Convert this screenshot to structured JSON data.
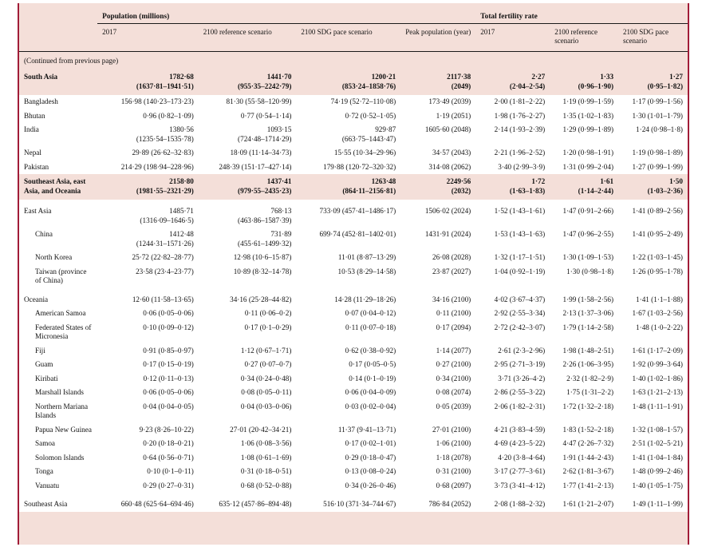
{
  "header": {
    "groups": [
      {
        "label": "Population (millions)",
        "span": 4
      },
      {
        "label": "Total fertility rate",
        "span": 3
      }
    ],
    "columns": [
      "",
      "2017",
      "2100 reference scenario",
      "2100 SDG pace scenario",
      "Peak population (year)",
      "2017",
      "2100 reference scenario",
      "2100 SDG pace scenario"
    ]
  },
  "note": "(Continued from previous page)",
  "rows": [
    {
      "kind": "region",
      "level": 0,
      "name": "South Asia",
      "pop_2017": "1782·68\n(1637·81–1941·51)",
      "pop_2100_ref": "1441·70\n(955·35–2242·79)",
      "pop_2100_sdg": "1200·21\n(853·24–1858·76)",
      "peak_pop": "2117·38\n(2049)",
      "tfr_2017": "2·27\n(2·04–2·54)",
      "tfr_2100_ref": "1·33\n(0·96–1·90)",
      "tfr_2100_sdg": "1·27\n(0·95–1·82)"
    },
    {
      "kind": "country",
      "level": 1,
      "name": "Bangladesh",
      "pop_2017": "156·98 (140·23–173·23)",
      "pop_2100_ref": "81·30 (55·58–120·99)",
      "pop_2100_sdg": "74·19 (52·72–110·08)",
      "peak_pop": "173·49 (2039)",
      "tfr_2017": "2·00 (1·81–2·22)",
      "tfr_2100_ref": "1·19 (0·99–1·59)",
      "tfr_2100_sdg": "1·17 (0·99–1·56)"
    },
    {
      "kind": "country",
      "level": 1,
      "name": "Bhutan",
      "pop_2017": "0·96 (0·82–1·09)",
      "pop_2100_ref": "0·77 (0·54–1·14)",
      "pop_2100_sdg": "0·72 (0·52–1·05)",
      "peak_pop": "1·19 (2051)",
      "tfr_2017": "1·98 (1·76–2·27)",
      "tfr_2100_ref": "1·35 (1·02–1·83)",
      "tfr_2100_sdg": "1·30 (1·01–1·79)"
    },
    {
      "kind": "country",
      "level": 1,
      "name": "India",
      "pop_2017": "1380·56\n(1235·54–1535·78)",
      "pop_2100_ref": "1093·15\n(724·48–1714·29)",
      "pop_2100_sdg": "929·87\n(663·75–1443·47)",
      "peak_pop": "1605·60 (2048)",
      "tfr_2017": "2·14 (1·93–2·39)",
      "tfr_2100_ref": "1·29 (0·99–1·89)",
      "tfr_2100_sdg": "1·24 (0·98–1·8)"
    },
    {
      "kind": "country",
      "level": 1,
      "name": "Nepal",
      "pop_2017": "29·89 (26·62–32·83)",
      "pop_2100_ref": "18·09 (11·14–34·73)",
      "pop_2100_sdg": "15·55 (10·34–29·96)",
      "peak_pop": "34·57 (2043)",
      "tfr_2017": "2·21 (1·96–2·52)",
      "tfr_2100_ref": "1·20 (0·98–1·91)",
      "tfr_2100_sdg": "1·19 (0·98–1·89)"
    },
    {
      "kind": "country",
      "level": 1,
      "name": "Pakistan",
      "pop_2017": "214·29 (198·94–228·96)",
      "pop_2100_ref": "248·39 (151·17–427·14)",
      "pop_2100_sdg": "179·88 (120·72–320·32)",
      "peak_pop": "314·08 (2062)",
      "tfr_2017": "3·40 (2·99–3·9)",
      "tfr_2100_ref": "1·31 (0·99–2·04)",
      "tfr_2100_sdg": "1·27 (0·99–1·99)"
    },
    {
      "kind": "region",
      "level": 0,
      "name": "Southeast Asia, east Asia, and Oceania",
      "pop_2017": "2158·80\n(1981·55–2321·29)",
      "pop_2100_ref": "1437·41\n(979·55–2435·23)",
      "pop_2100_sdg": "1263·48\n(864·11–2156·81)",
      "peak_pop": "2249·56\n(2032)",
      "tfr_2017": "1·72\n(1·63–1·83)",
      "tfr_2100_ref": "1·61\n(1·14–2·44)",
      "tfr_2100_sdg": "1·50\n(1·03–2·36)"
    },
    {
      "kind": "subregion",
      "level": 1,
      "name": "East Asia",
      "pop_2017": "1485·71\n(1316·09–1646·5)",
      "pop_2100_ref": "768·13\n(463·86–1587·39)",
      "pop_2100_sdg": "733·09 (457·41–1486·17)",
      "peak_pop": "1506·02 (2024)",
      "tfr_2017": "1·52 (1·43–1·61)",
      "tfr_2100_ref": "1·47 (0·91–2·66)",
      "tfr_2100_sdg": "1·41 (0·89–2·56)"
    },
    {
      "kind": "country",
      "level": 2,
      "name": "China",
      "pop_2017": "1412·48\n(1244·31–1571·26)",
      "pop_2100_ref": "731·89\n(455·61–1499·32)",
      "pop_2100_sdg": "699·74 (452·81–1402·01)",
      "peak_pop": "1431·91 (2024)",
      "tfr_2017": "1·53 (1·43–1·63)",
      "tfr_2100_ref": "1·47 (0·96–2·55)",
      "tfr_2100_sdg": "1·41 (0·95–2·49)"
    },
    {
      "kind": "country",
      "level": 2,
      "name": "North Korea",
      "pop_2017": "25·72 (22·82–28·77)",
      "pop_2100_ref": "12·98 (10·6–15·87)",
      "pop_2100_sdg": "11·01 (8·87–13·29)",
      "peak_pop": "26·08 (2028)",
      "tfr_2017": "1·32 (1·17–1·51)",
      "tfr_2100_ref": "1·30 (1·09–1·53)",
      "tfr_2100_sdg": "1·22 (1·03–1·45)"
    },
    {
      "kind": "country",
      "level": 2,
      "name": "Taiwan (province of China)",
      "pop_2017": "23·58 (23·4–23·77)",
      "pop_2100_ref": "10·89 (8·32–14·78)",
      "pop_2100_sdg": "10·53 (8·29–14·58)",
      "peak_pop": "23·87 (2027)",
      "tfr_2017": "1·04 (0·92–1·19)",
      "tfr_2100_ref": "1·30 (0·98–1·8)",
      "tfr_2100_sdg": "1·26 (0·95–1·78)"
    },
    {
      "kind": "subregion",
      "level": 1,
      "name": "Oceania",
      "pop_2017": "12·60 (11·58–13·65)",
      "pop_2100_ref": "34·16 (25·28–44·82)",
      "pop_2100_sdg": "14·28 (11·29–18·26)",
      "peak_pop": "34·16 (2100)",
      "tfr_2017": "4·02 (3·67–4·37)",
      "tfr_2100_ref": "1·99 (1·58–2·56)",
      "tfr_2100_sdg": "1·41 (1·1–1·88)"
    },
    {
      "kind": "country",
      "level": 2,
      "name": "American Samoa",
      "pop_2017": "0·06 (0·05–0·06)",
      "pop_2100_ref": "0·11 (0·06–0·2)",
      "pop_2100_sdg": "0·07 (0·04–0·12)",
      "peak_pop": "0·11 (2100)",
      "tfr_2017": "2·92 (2·55–3·34)",
      "tfr_2100_ref": "2·13 (1·37–3·06)",
      "tfr_2100_sdg": "1·67 (1·03–2·56)"
    },
    {
      "kind": "country",
      "level": 2,
      "name": "Federated States of Micronesia",
      "pop_2017": "0·10 (0·09–0·12)",
      "pop_2100_ref": "0·17 (0·1–0·29)",
      "pop_2100_sdg": "0·11 (0·07–0·18)",
      "peak_pop": "0·17 (2094)",
      "tfr_2017": "2·72 (2·42–3·07)",
      "tfr_2100_ref": "1·79 (1·14–2·58)",
      "tfr_2100_sdg": "1·48 (1·0–2·22)"
    },
    {
      "kind": "country",
      "level": 2,
      "name": "Fiji",
      "pop_2017": "0·91 (0·85–0·97)",
      "pop_2100_ref": "1·12 (0·67–1·71)",
      "pop_2100_sdg": "0·62 (0·38–0·92)",
      "peak_pop": "1·14 (2077)",
      "tfr_2017": "2·61 (2·3–2·96)",
      "tfr_2100_ref": "1·98 (1·48–2·51)",
      "tfr_2100_sdg": "1·61 (1·17–2·09)"
    },
    {
      "kind": "country",
      "level": 2,
      "name": "Guam",
      "pop_2017": "0·17 (0·15–0·19)",
      "pop_2100_ref": "0·27 (0·07–0·7)",
      "pop_2100_sdg": "0·17 (0·05–0·5)",
      "peak_pop": "0·27 (2100)",
      "tfr_2017": "2·95 (2·71–3·19)",
      "tfr_2100_ref": "2·26 (1·06–3·95)",
      "tfr_2100_sdg": "1·92 (0·99–3·64)"
    },
    {
      "kind": "country",
      "level": 2,
      "name": "Kiribati",
      "pop_2017": "0·12 (0·11–0·13)",
      "pop_2100_ref": "0·34 (0·24–0·48)",
      "pop_2100_sdg": "0·14 (0·1–0·19)",
      "peak_pop": "0·34 (2100)",
      "tfr_2017": "3·71 (3·26–4·2)",
      "tfr_2100_ref": "2·32 (1·82–2·9)",
      "tfr_2100_sdg": "1·40 (1·02–1·86)"
    },
    {
      "kind": "country",
      "level": 2,
      "name": "Marshall Islands",
      "pop_2017": "0·06 (0·05–0·06)",
      "pop_2100_ref": "0·08 (0·05–0·11)",
      "pop_2100_sdg": "0·06 (0·04–0·09)",
      "peak_pop": "0·08 (2074)",
      "tfr_2017": "2·86 (2·55–3·22)",
      "tfr_2100_ref": "1·75 (1·31–2·2)",
      "tfr_2100_sdg": "1·63 (1·21–2·13)"
    },
    {
      "kind": "country",
      "level": 2,
      "name": "Northern Mariana Islands",
      "pop_2017": "0·04 (0·04–0·05)",
      "pop_2100_ref": "0·04 (0·03–0·06)",
      "pop_2100_sdg": "0·03 (0·02–0·04)",
      "peak_pop": "0·05 (2039)",
      "tfr_2017": "2·06 (1·82–2·31)",
      "tfr_2100_ref": "1·72 (1·32–2·18)",
      "tfr_2100_sdg": "1·48 (1·11–1·91)"
    },
    {
      "kind": "country",
      "level": 2,
      "name": "Papua New Guinea",
      "pop_2017": "9·23 (8·26–10·22)",
      "pop_2100_ref": "27·01 (20·42–34·21)",
      "pop_2100_sdg": "11·37 (9·41–13·71)",
      "peak_pop": "27·01 (2100)",
      "tfr_2017": "4·21 (3·83–4·59)",
      "tfr_2100_ref": "1·83 (1·52–2·18)",
      "tfr_2100_sdg": "1·32 (1·08–1·57)"
    },
    {
      "kind": "country",
      "level": 2,
      "name": "Samoa",
      "pop_2017": "0·20 (0·18–0·21)",
      "pop_2100_ref": "1·06 (0·08–3·56)",
      "pop_2100_sdg": "0·17 (0·02–1·01)",
      "peak_pop": "1·06 (2100)",
      "tfr_2017": "4·69 (4·23–5·22)",
      "tfr_2100_ref": "4·47 (2·26–7·32)",
      "tfr_2100_sdg": "2·51 (1·02–5·21)"
    },
    {
      "kind": "country",
      "level": 2,
      "name": "Solomon Islands",
      "pop_2017": "0·64 (0·56–0·71)",
      "pop_2100_ref": "1·08 (0·61–1·69)",
      "pop_2100_sdg": "0·29 (0·18–0·47)",
      "peak_pop": "1·18 (2078)",
      "tfr_2017": "4·20 (3·8–4·64)",
      "tfr_2100_ref": "1·91 (1·44–2·43)",
      "tfr_2100_sdg": "1·41 (1·04–1·84)"
    },
    {
      "kind": "country",
      "level": 2,
      "name": "Tonga",
      "pop_2017": "0·10 (0·1–0·11)",
      "pop_2100_ref": "0·31 (0·18–0·51)",
      "pop_2100_sdg": "0·13 (0·08–0·24)",
      "peak_pop": "0·31 (2100)",
      "tfr_2017": "3·17 (2·77–3·61)",
      "tfr_2100_ref": "2·62 (1·81–3·67)",
      "tfr_2100_sdg": "1·48 (0·99–2·46)"
    },
    {
      "kind": "country",
      "level": 2,
      "name": "Vanuatu",
      "pop_2017": "0·29 (0·27–0·31)",
      "pop_2100_ref": "0·68 (0·52–0·88)",
      "pop_2100_sdg": "0·34 (0·26–0·46)",
      "peak_pop": "0·68 (2097)",
      "tfr_2017": "3·73 (3·41–4·12)",
      "tfr_2100_ref": "1·77 (1·41–2·13)",
      "tfr_2100_sdg": "1·40 (1·05–1·75)"
    },
    {
      "kind": "subregion",
      "level": 1,
      "name": "Southeast Asia",
      "pop_2017": "660·48 (625·64–694·46)",
      "pop_2100_ref": "635·12 (457·86–894·48)",
      "pop_2100_sdg": "516·10 (371·34–744·67)",
      "peak_pop": "786·84 (2052)",
      "tfr_2017": "2·08 (1·88–2·32)",
      "tfr_2100_ref": "1·61 (1·21–2·07)",
      "tfr_2100_sdg": "1·49 (1·11–1·99)"
    }
  ],
  "colors": {
    "panel_background": "#f4dfd9",
    "row_background": "#ffffff",
    "rule": "#a11c38",
    "text": "#111111"
  }
}
